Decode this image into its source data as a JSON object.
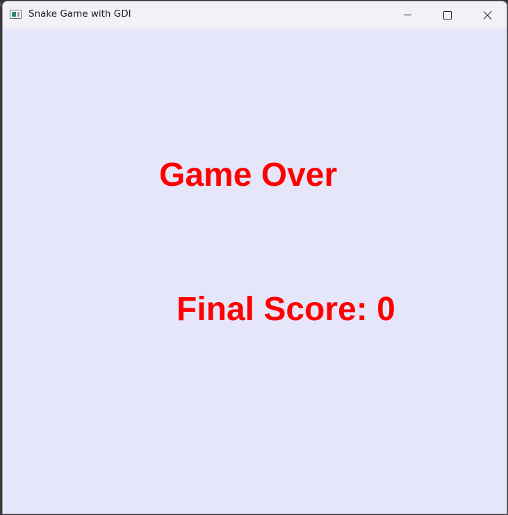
{
  "window": {
    "title": "Snake Game with GDI",
    "app_icon": "window-app-icon",
    "controls": {
      "minimize_icon": "minimize-icon",
      "maximize_icon": "maximize-icon",
      "close_icon": "close-icon"
    }
  },
  "game": {
    "status_text": "Game Over",
    "score_label": "Final Score:",
    "score_value": "0",
    "background_color": "#e6e6fa",
    "text_color": "#ff0000"
  }
}
